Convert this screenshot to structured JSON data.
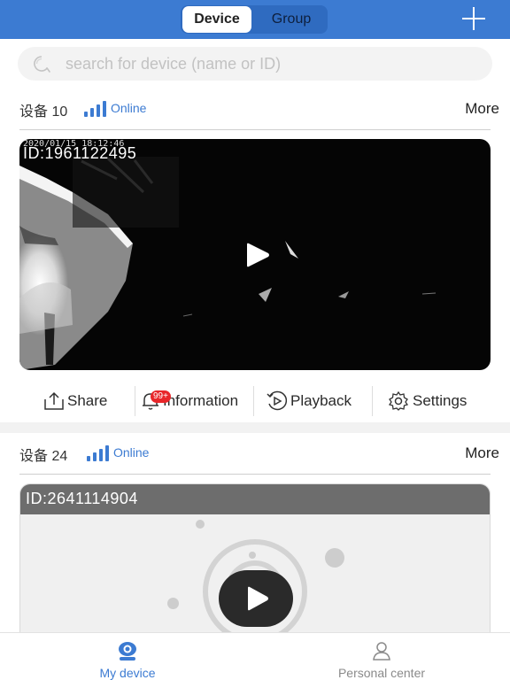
{
  "header": {
    "tabs": [
      {
        "label": "Device",
        "active": true
      },
      {
        "label": "Group",
        "active": false
      }
    ],
    "add_icon": "plus-icon"
  },
  "search": {
    "placeholder": "search for device (name or ID)",
    "value": "",
    "icon": "search-icon"
  },
  "devices": [
    {
      "name": "设备 10",
      "status": "Online",
      "more_label": "More",
      "osd_timestamp": "2020/01/15 18:12:46",
      "osd_id": "ID:1961122495",
      "actions": [
        {
          "label": "Share",
          "icon": "share-icon"
        },
        {
          "label": "Information",
          "icon": "bell-icon",
          "badge": "99+"
        },
        {
          "label": "Playback",
          "icon": "playback-icon"
        },
        {
          "label": "Settings",
          "icon": "gear-icon"
        }
      ]
    },
    {
      "name": "设备 24",
      "status": "Online",
      "more_label": "More",
      "osd_id": "ID:2641114904"
    }
  ],
  "tabbar": {
    "items": [
      {
        "label": "My device",
        "icon": "camera-icon",
        "active": true
      },
      {
        "label": "Personal center",
        "icon": "person-icon",
        "active": false
      }
    ]
  },
  "colors": {
    "brand": "#3c7bd2",
    "badge": "#e8262a",
    "inactive_tab": "#8a8a8a"
  }
}
